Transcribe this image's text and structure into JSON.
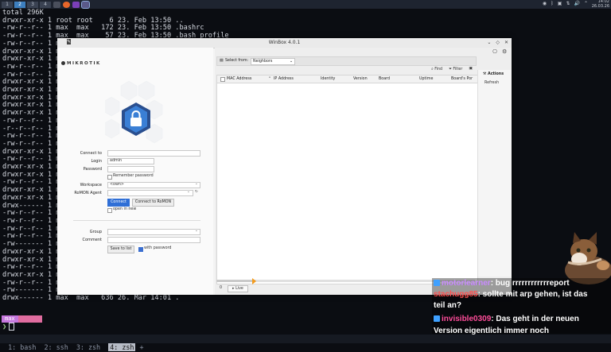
{
  "topbar": {
    "workspaces": [
      "1",
      "2",
      "3",
      "4"
    ],
    "active_workspace": 1,
    "clock_time": "14:02",
    "clock_date": "26.03.26"
  },
  "terminal": {
    "lines": [
      "total 296K",
      "drwxr-xr-x 1 root root    6 23. Feb 13:50 ..",
      "-rw-r--r-- 1 max  max   172 23. Feb 13:50 .bashrc",
      "-rw-r--r-- 1 max  max    57 23. Feb 13:50 .bash_profile",
      "-rw-r--r-- 1 m",
      "drwxr-xr-x 1 m",
      "drwxr-xr-x 1 m",
      "-rw-r--r-- 1 m",
      "-rw-r--r-- 1 m",
      "drwxr-xr-x 1 m",
      "drwxr-xr-x 1 m",
      "drwxr-xr-x 1 m",
      "drwxr-xr-x 1 m",
      "drwxr-xr-x 1 m",
      "-rw-r--r-- 1 m",
      "-r--r--r-- 1 m",
      "-rw-r--r-- 1 m",
      "-rw-r--r-- 1 m",
      "drwxr-xr-x 1 m",
      "-rw-r--r-- 1 m",
      "drwxr-xr-x 1 m",
      "drwxr-xr-x 1 m",
      "-rw-r--r-- 1 m",
      "drwxr-xr-x 1 m",
      "drwxr-xr-x 1 m",
      "drwx------ 1 m",
      "-rw-r--r-- 1 m",
      "-rw-r--r-- 1 m",
      "-rw-r--r-- 1 m",
      "-rw-r--r-- 1 m",
      "-rw------- 1 m",
      "drwxr-xr-x 1 m",
      "drwxr-xr-x 1 m",
      "-rw-r--r-- 1 m",
      "drwxr-xr-x 1 m",
      "-rw-r--r-- 1 m",
      "-rw------- 1 m",
      "drwx------ 1 max  max   636 26. Mar 14:01 ."
    ],
    "prompt_label": "max",
    "prompt_symbol": "❯"
  },
  "tmux": {
    "windows": [
      "1: bash",
      "2: ssh",
      "3: zsh"
    ],
    "current": "4: zsh",
    "new": "+"
  },
  "winbox": {
    "title": "WinBox 4.0.1",
    "logo": "MIKROTIK",
    "form": {
      "connect_to_label": "Connect to",
      "connect_to_value": "",
      "login_label": "Login",
      "login_value": "admin",
      "password_label": "Password",
      "password_value": "",
      "remember_password": "Remember password",
      "workspace_label": "Workspace",
      "workspace_value": "<own>",
      "romon_label": "RoMON Agent",
      "romon_value": "",
      "connect_button": "Connect",
      "romon_button": "Connect to RoMON",
      "open_new": "open in new",
      "group_label": "Group",
      "group_value": "",
      "comment_label": "Comment",
      "comment_value": "",
      "save_button": "Save to list",
      "with_password": "with password"
    },
    "neighbors": {
      "select_from_label": "Select from:",
      "select_from_value": "Neighbors",
      "find": "Find",
      "filter": "Filter",
      "columns": [
        "MAC Address",
        "IP Address",
        "Identity",
        "Version",
        "Board",
        "Uptime",
        "Board's Por"
      ],
      "actions_header": "Actions",
      "refresh": "Refresh",
      "count": "0",
      "live": "Live",
      "progress": 0.15
    }
  },
  "chat": {
    "lines": [
      {
        "user": "motorlearner",
        "text": ": bug rrrrrrrrrrrreport"
      },
      {
        "user": "stachugg85",
        "text": ": sollte mit arp gehen, ist das"
      },
      {
        "user": "",
        "text": "teil an?"
      },
      {
        "user": "invisible0309",
        "text": ": Das geht in der neuen"
      },
      {
        "user": "",
        "text": "Version eigentlich immer noch"
      }
    ]
  },
  "colors": {
    "accent": "#2f6fd6",
    "terminal_bg": "#0b0d12",
    "winbox_bg": "#f4f4f4",
    "prompt_purple": "#c678dd",
    "prompt_pink": "#e06c9f",
    "marker_orange": "#f39c1f"
  }
}
